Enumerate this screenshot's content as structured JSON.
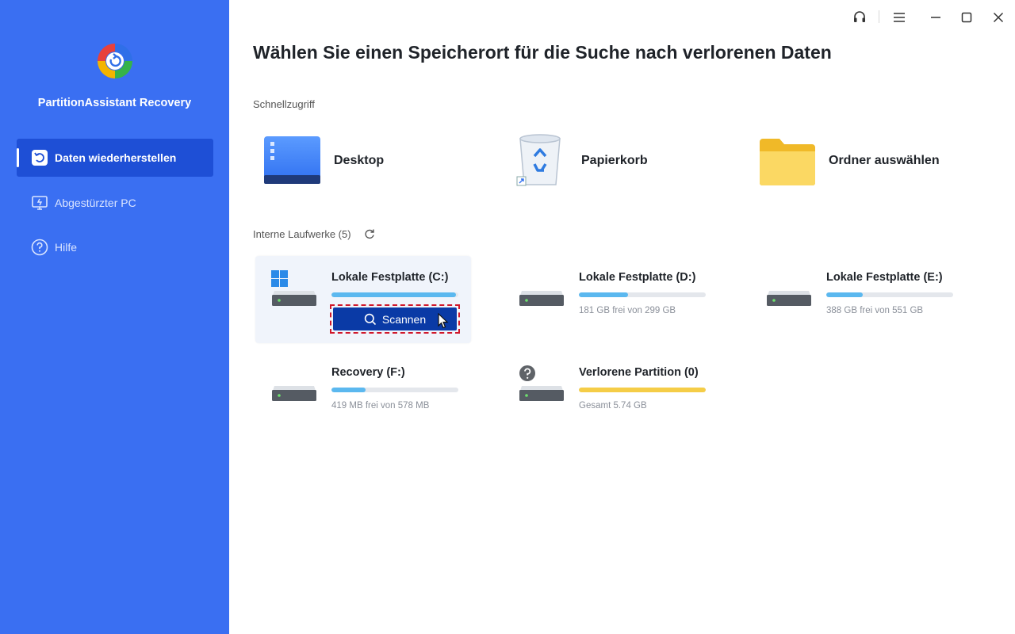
{
  "app": {
    "name": "PartitionAssistant Recovery"
  },
  "sidebar": {
    "items": [
      {
        "label": "Daten wiederherstellen",
        "icon": "restore-icon",
        "active": true
      },
      {
        "label": "Abgestürzter PC",
        "icon": "monitor-icon",
        "active": false
      },
      {
        "label": "Hilfe",
        "icon": "help-icon",
        "active": false
      }
    ]
  },
  "titlebar": {
    "icons": [
      "headset-icon",
      "menu-icon",
      "minimize-icon",
      "maximize-icon",
      "close-icon"
    ]
  },
  "main": {
    "title": "Wählen Sie einen Speicherort für die Suche nach verlorenen Daten",
    "quick_access_label": "Schnellzugriff",
    "quick_access": [
      {
        "label": "Desktop",
        "icon": "desktop-icon"
      },
      {
        "label": "Papierkorb",
        "icon": "recycle-bin-icon"
      },
      {
        "label": "Ordner auswählen",
        "icon": "folder-icon"
      }
    ],
    "drives_label": "Interne Laufwerke (5)",
    "drives": [
      {
        "name": "Lokale Festplatte (C:)",
        "info": "",
        "usage": 0.98,
        "selected": true,
        "scan_label": "Scannen"
      },
      {
        "name": "Lokale Festplatte (D:)",
        "info": "181 GB frei von 299 GB",
        "usage": 0.39
      },
      {
        "name": "Lokale Festplatte (E:)",
        "info": "388 GB frei von 551 GB",
        "usage": 0.29
      },
      {
        "name": "Recovery (F:)",
        "info": "419 MB frei von 578 MB",
        "usage": 0.27
      },
      {
        "name": "Verlorene Partition (0)",
        "info": "Gesamt 5.74 GB",
        "usage": 1.0
      }
    ]
  },
  "colors": {
    "sidebar": "#3a6ff2",
    "sidebar_active": "#1e4fd6",
    "scan_button": "#0a3aa6",
    "bar_fill": "#5bb8ef",
    "bar_lost": "#f5cd47"
  }
}
